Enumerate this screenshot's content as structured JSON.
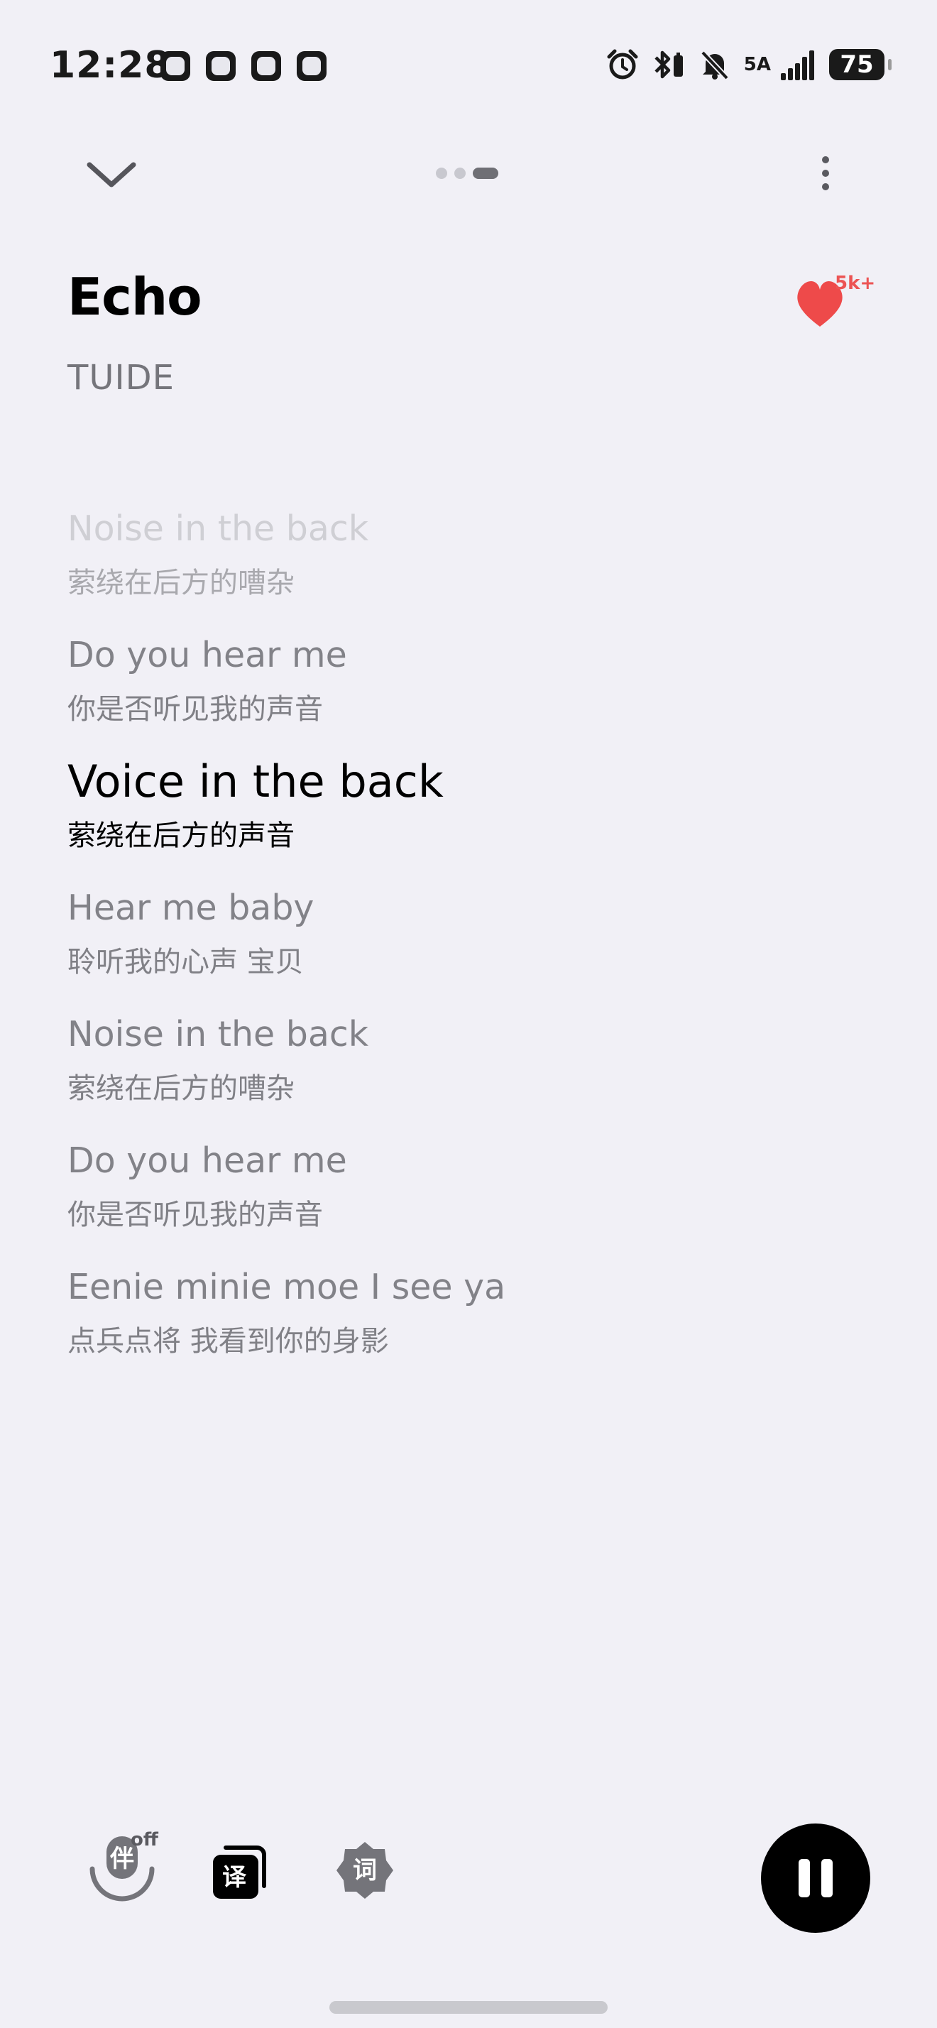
{
  "status_bar": {
    "time": "12:28",
    "network": "5A",
    "battery": "75",
    "notification_icons": [
      "app-notification-icon",
      "app-notification-icon",
      "app-notification-icon",
      "app-notification-icon"
    ],
    "system_icons": [
      "alarm-icon",
      "bluetooth-icon",
      "mute-icon",
      "signal-icon",
      "battery-icon"
    ]
  },
  "nav": {
    "collapse_icon": "chevron-down-icon",
    "more_icon": "more-vertical-icon",
    "page_count": 3,
    "active_page": 3
  },
  "song": {
    "title": "Echo",
    "artist": "TUIDE",
    "like_count": "5k+",
    "liked": true,
    "like_color": "#ee4a4a"
  },
  "lyrics": [
    {
      "text": "Noise in the back",
      "translation": "萦绕在后方的嘈杂",
      "state": "past"
    },
    {
      "text": "Do you hear me",
      "translation": "你是否听见我的声音",
      "state": "upcoming"
    },
    {
      "text": "Voice in the back",
      "translation": "萦绕在后方的声音",
      "state": "current"
    },
    {
      "text": "Hear me baby",
      "translation": "聆听我的心声 宝贝",
      "state": "upcoming"
    },
    {
      "text": "Noise in the back",
      "translation": "萦绕在后方的嘈杂",
      "state": "upcoming"
    },
    {
      "text": "Do you hear me",
      "translation": "你是否听见我的声音",
      "state": "upcoming"
    },
    {
      "text": "Eenie minie moe I see ya",
      "translation": "点兵点将 我看到你的身影",
      "state": "upcoming"
    }
  ],
  "controls": {
    "accompaniment_glyph": "伴",
    "accompaniment_status": "off",
    "translation_glyph": "译",
    "lyrics_glyph": "词",
    "play_state": "playing",
    "pause_icon": "pause-icon"
  }
}
